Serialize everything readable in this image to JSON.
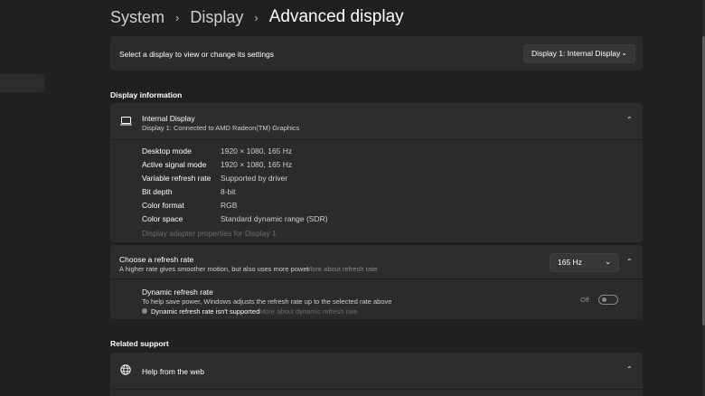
{
  "breadcrumb": {
    "system": "System",
    "display": "Display",
    "current": "Advanced display",
    "separator": "›"
  },
  "select_display": {
    "label": "Select a display to view or change its settings",
    "dropdown_value": "Display 1: Internal Display"
  },
  "display_information": {
    "section_title": "Display information",
    "device_name": "Internal Display",
    "device_sub": "Display 1: Connected to AMD Radeon(TM) Graphics",
    "properties": [
      {
        "label": "Desktop mode",
        "value": "1920 × 1080, 165 Hz"
      },
      {
        "label": "Active signal mode",
        "value": "1920 × 1080, 165 Hz"
      },
      {
        "label": "Variable refresh rate",
        "value": "Supported by driver"
      },
      {
        "label": "Bit depth",
        "value": "8-bit"
      },
      {
        "label": "Color format",
        "value": "RGB"
      },
      {
        "label": "Color space",
        "value": "Standard dynamic range (SDR)"
      }
    ],
    "adapter_link": "Display adapter properties for Display 1"
  },
  "refresh_rate": {
    "title": "Choose a refresh rate",
    "subtitle": "A higher rate gives smoother motion, but also uses more power",
    "more_link": "More about refresh rate",
    "dropdown_value": "165 Hz",
    "dynamic": {
      "title": "Dynamic refresh rate",
      "subtitle": "To help save power, Windows adjusts the refresh rate up to the selected rate above",
      "warning": "Dynamic refresh rate isn't supported",
      "more_link": "More about dynamic refresh rate",
      "toggle_label": "Off"
    }
  },
  "related_support": {
    "section_title": "Related support",
    "help_item": "Help from the web"
  },
  "icons": {
    "chevron_down": "⌄",
    "chevron_up": "⌃"
  },
  "colors": {
    "background": "#202020",
    "card": "#2b2b2b",
    "muted_text": "#8a8a8a"
  }
}
